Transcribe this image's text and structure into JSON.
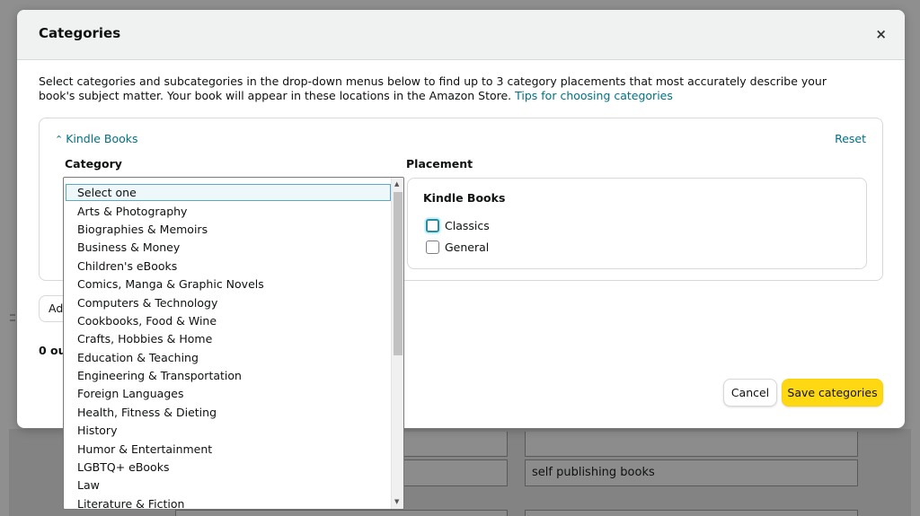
{
  "modal": {
    "title": "Categories",
    "close_symbol": "×",
    "description": "Select categories and subcategories in the drop-down menus below to find up to 3 category placements that most accurately describe your book's subject matter. Your book will appear in these locations in the Amazon Store.",
    "tips_link": "Tips for choosing categories"
  },
  "category_section": {
    "toggle_label": "Kindle Books",
    "reset_label": "Reset",
    "category_col_label": "Category",
    "placement_col_label": "Placement"
  },
  "placement": {
    "title": "Kindle Books",
    "options": [
      {
        "label": "Classics",
        "checked": false,
        "focused": true
      },
      {
        "label": "General",
        "checked": false,
        "focused": false
      }
    ]
  },
  "partial": {
    "add_label": "Add",
    "count_text": "0 out"
  },
  "actions": {
    "cancel_label": "Cancel",
    "save_label": "Save categories"
  },
  "dropdown": {
    "selected": "Select one",
    "options": [
      "Select one",
      "Arts & Photography",
      "Biographies & Memoirs",
      "Business & Money",
      "Children's eBooks",
      "Comics, Manga & Graphic Novels",
      "Computers & Technology",
      "Cookbooks, Food & Wine",
      "Crafts, Hobbies & Home",
      "Education & Teaching",
      "Engineering & Transportation",
      "Foreign Languages",
      "Health, Fitness & Dieting",
      "History",
      "Humor & Entertainment",
      "LGBTQ+ eBooks",
      "Law",
      "Literature & Fiction"
    ]
  },
  "background": {
    "keyword_field_value": "self publishing books"
  },
  "colors": {
    "link": "#007185",
    "primary_button": "#ffd814",
    "focus_ring": "#2b8ca0"
  }
}
